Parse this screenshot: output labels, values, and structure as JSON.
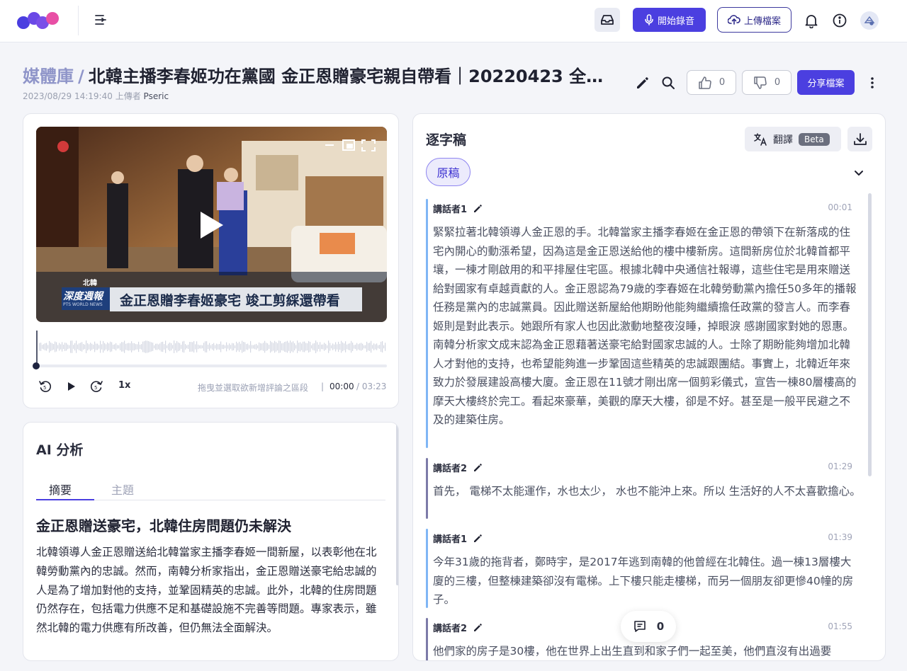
{
  "topbar": {
    "record_label": "開始錄音",
    "upload_label": "上傳檔案",
    "colors": {
      "primary": "#4b3fe0",
      "logo_blue": "#4a3ee0",
      "logo_pink": "#e84fa5"
    }
  },
  "header": {
    "library": "媒體庫",
    "separator": "/",
    "title": "北韓主播李春姬功在黨國 金正恩贈豪宅親自帶看｜20220423 全…",
    "date": "2023/08/29 14:19:40",
    "uploader_label": "上傳者",
    "uploader": "Pseric",
    "likes": "0",
    "dislikes": "0",
    "share_label": "分享檔案"
  },
  "player": {
    "video_caption_main": "金正恩贈李春姬豪宅  竣工剪綵還帶看",
    "video_caption_badge": "深度週報",
    "video_caption_sub": "PTS WORLD NEWS",
    "video_region": "北韓",
    "speed": "1x",
    "hint": "拖曳並選取欲新增評論之區段",
    "time_separator": "|",
    "current_time": "00:00",
    "total_time": "/ 03:23",
    "progress": 0
  },
  "ai": {
    "title": "AI 分析",
    "tabs": [
      "摘要",
      "主題"
    ],
    "summary_heading": "金正恩贈送豪宅，北韓住房問題仍未解決",
    "summary_body": "北韓領導人金正恩贈送給北韓當家主播李春姬一間新屋，以表彰他在北韓勞動黨內的忠誠。然而，南韓分析家指出，金正恩贈送豪宅給忠誠的人是為了增加對他的支持，並鞏固精英的忠誠。此外，北韓的住房問題仍然存在，包括電力供應不足和基礎設施不完善等問題。專家表示，雖然北韓的電力供應有所改善，但仍無法全面解決。"
  },
  "transcript": {
    "title": "逐字稿",
    "translate_label": "翻譯",
    "beta_label": "Beta",
    "original_label": "原稿",
    "segments": [
      {
        "speaker": "講話者1",
        "time": "00:01",
        "text": "緊緊拉著北韓領導人金正恩的手。北韓當家主播李春姬在金正恩的帶領下在新落成的住宅內開心的動漲希望，因為這是金正恩送給他的樓中樓新房。這間新房位於北韓首都平壤，一棟才剛啟用的和平排屋住宅區。根據北韓中央通信社報導，這些住宅是用來贈送給對國家有卓越貢獻的人。金正恩認為79歲的李春姬在北韓勞動黨內擔任50多年的播報任務是黨內的忠誠黨員。因此贈送新屋給他期盼他能夠繼續擔任政黨的發言人。而李春姬則是對此表示。她跟所有家人也因此激動地整夜沒睡，掉眼淚 感謝國家對她的恩惠。南韓分析家文成末認為金正恩藉著送豪宅給對國家忠誠的人。士除了期盼能夠增加北韓人才對他的支持，也希望能夠進一步鞏固這些精英的忠誠跟團結。事實上，北韓近年來致力於發展建設高樓大廈。金正恩在11號才剛出席一個剪彩儀式，宣告一棟80層樓高的摩天大樓終於完工。看起來豪華，美觀的摩天大樓，卻是不好。甚至是一般平民避之不及的建築住房。"
      },
      {
        "speaker": "講話者2",
        "time": "01:29",
        "text": "首先， 電梯不太能運作，水也太少， 水也不能沖上來。所以 生活好的人不太喜歡擔心。"
      },
      {
        "speaker": "講話者1",
        "time": "01:39",
        "text": "今年31歲的拖背者，鄭時宇，是2017年逃到南韓的他曾經在北韓住。過一棟13層樓大廈的三樓，但整棟建築卻沒有電梯。上下樓只能走樓梯，而另一個朋友卻更慘40幢的房子。"
      },
      {
        "speaker": "講話者2",
        "time": "01:55",
        "text": "他們家的房子是30樓，他在世界上出生直到和家子們一起至美，他們直沒有出過要"
      }
    ],
    "comment_count": "0"
  }
}
